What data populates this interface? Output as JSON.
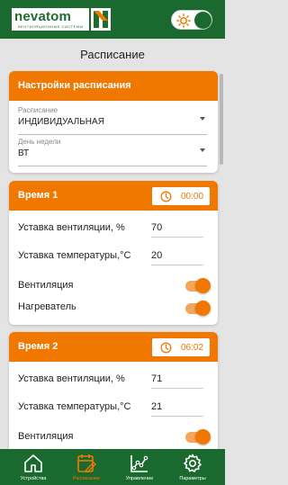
{
  "header": {
    "logo_text": "nevatom",
    "logo_sub": "ВЕНТИЛЯЦИОННЫЕ СИСТЕМЫ"
  },
  "page_title": "Расписание",
  "settings_card": {
    "title": "Настройки расписания",
    "fields": [
      {
        "label": "Расписание",
        "value": "ИНДИВИДУАЛЬНАЯ"
      },
      {
        "label": "День недели",
        "value": "ВТ"
      }
    ]
  },
  "time_cards": [
    {
      "title": "Время 1",
      "time": "00:00",
      "vent_label": "Уставка вентиляции, %",
      "vent_value": "70",
      "temp_label": "Уставка температуры,°С",
      "temp_value": "20",
      "toggle1_label": "Вентиляция",
      "toggle2_label": "Нагреватель"
    },
    {
      "title": "Время 2",
      "time": "06:02",
      "vent_label": "Уставка вентиляции, %",
      "vent_value": "71",
      "temp_label": "Уставка температуры,°С",
      "temp_value": "21",
      "toggle1_label": "Вентиляция"
    }
  ],
  "nav": [
    {
      "label": "Устройства",
      "icon": "home-icon"
    },
    {
      "label": "Расписание",
      "icon": "schedule-icon"
    },
    {
      "label": "Управление",
      "icon": "chart-icon"
    },
    {
      "label": "Параметры",
      "icon": "gear-icon"
    }
  ],
  "colors": {
    "brand_green": "#1a6a2f",
    "accent_orange": "#f07800"
  }
}
